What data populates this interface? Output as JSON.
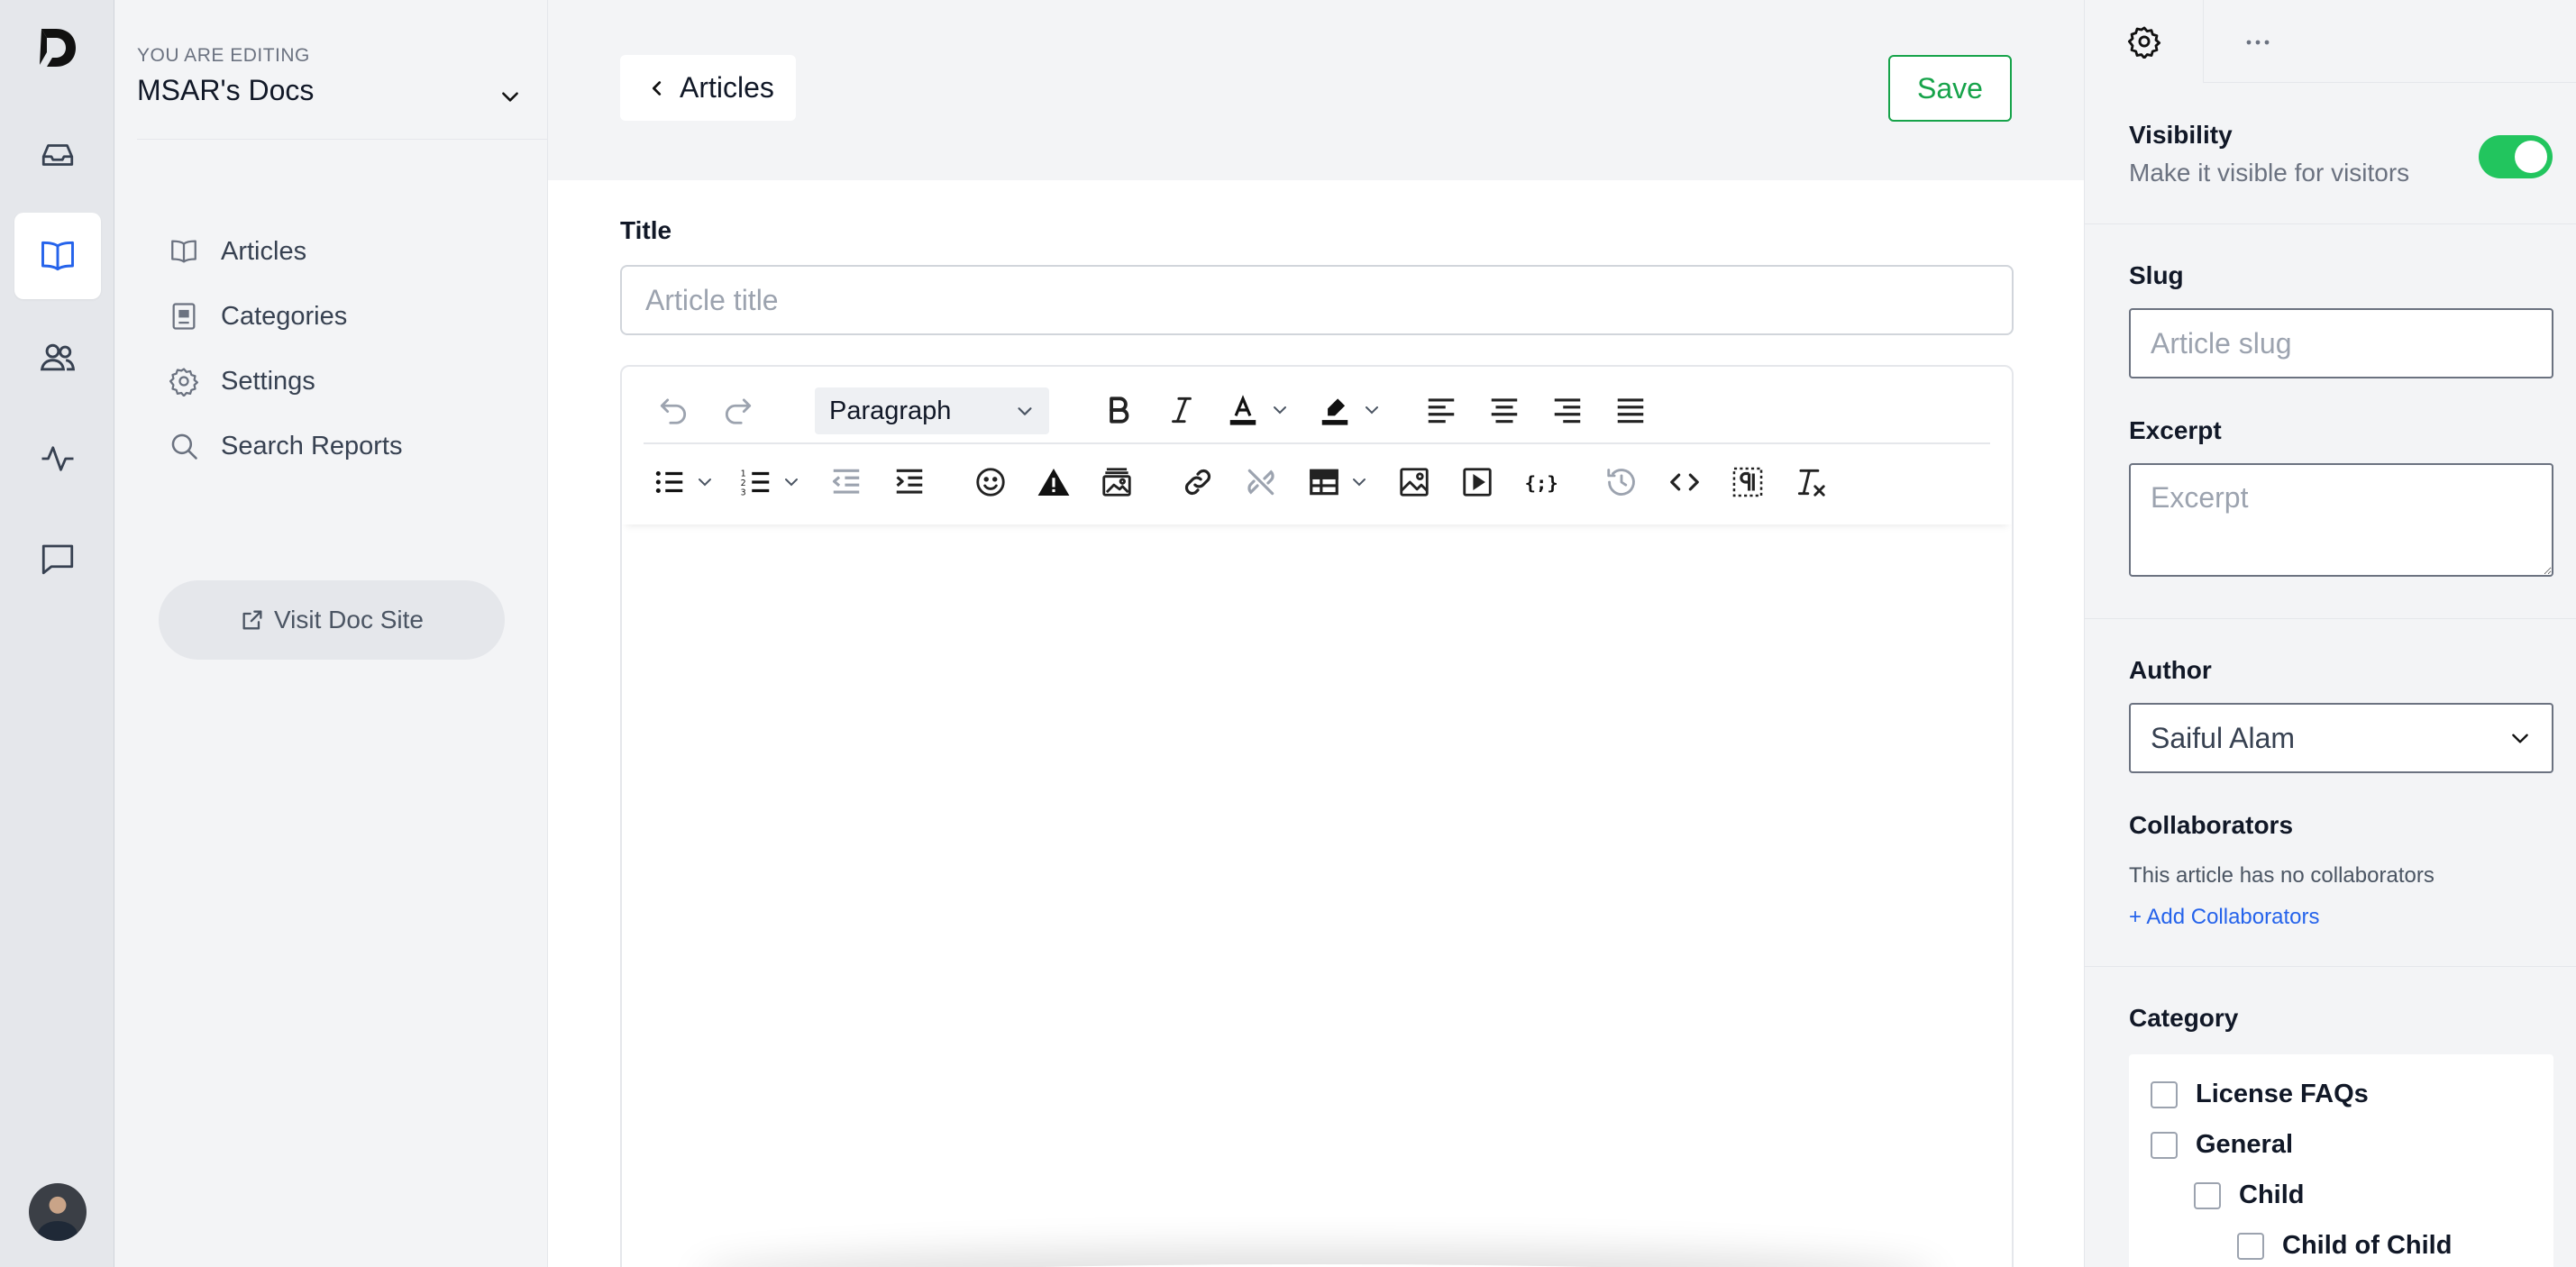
{
  "workspace": {
    "eyebrow": "YOU ARE EDITING",
    "name": "MSAR's Docs"
  },
  "rail": {
    "items": [
      {
        "icon": "inbox-icon"
      },
      {
        "icon": "book-icon",
        "active": true
      },
      {
        "icon": "users-icon"
      },
      {
        "icon": "activity-icon"
      },
      {
        "icon": "chat-icon"
      }
    ]
  },
  "sidebar": {
    "items": [
      {
        "label": "Articles",
        "icon": "book-icon"
      },
      {
        "label": "Categories",
        "icon": "categories-icon"
      },
      {
        "label": "Settings",
        "icon": "gear-icon"
      },
      {
        "label": "Search Reports",
        "icon": "search-icon"
      }
    ],
    "visit_label": "Visit Doc Site"
  },
  "header": {
    "back_label": "Articles",
    "save_label": "Save"
  },
  "form": {
    "title_label": "Title",
    "title_placeholder": "Article title",
    "title_value": ""
  },
  "toolbar": {
    "block_format": "Paragraph"
  },
  "panel": {
    "visibility": {
      "label": "Visibility",
      "sub": "Make it visible for visitors",
      "enabled": true
    },
    "slug": {
      "label": "Slug",
      "placeholder": "Article slug"
    },
    "excerpt": {
      "label": "Excerpt",
      "placeholder": "Excerpt"
    },
    "author": {
      "label": "Author",
      "value": "Saiful Alam"
    },
    "collaborators": {
      "label": "Collaborators",
      "empty": "This article has no collaborators",
      "add_label": "+ Add Collaborators"
    },
    "category": {
      "label": "Category",
      "items": [
        {
          "label": "License FAQs",
          "level": 0
        },
        {
          "label": "General",
          "level": 0
        },
        {
          "label": "Child",
          "level": 1
        },
        {
          "label": "Child of Child",
          "level": 2
        }
      ]
    }
  },
  "colors": {
    "accent": "#2563eb",
    "success": "#16a34a",
    "toggle_on": "#22c55e"
  }
}
